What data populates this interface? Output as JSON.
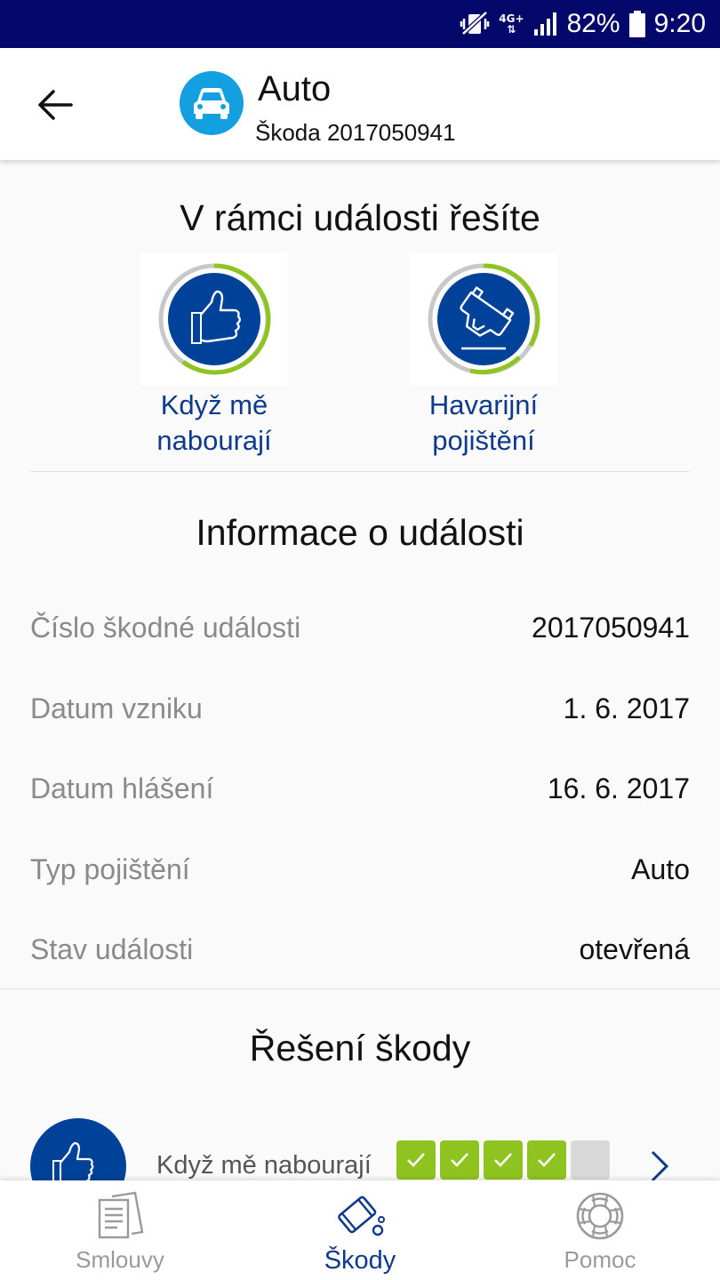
{
  "status_bar": {
    "mute_icon": "vibrate-mute-icon",
    "network": "4G+",
    "battery_percent": "82%",
    "time": "9:20"
  },
  "header": {
    "back_icon": "arrow-left-icon",
    "product_icon": "car-icon",
    "title": "Auto",
    "subtitle": "Škoda 2017050941"
  },
  "categories_section": {
    "title": "V rámci události řešíte",
    "items": [
      {
        "label_line1": "Když mě",
        "label_line2": "nabourají",
        "icon": "thumbs-up-icon"
      },
      {
        "label_line1": "Havarijní",
        "label_line2": "pojištění",
        "icon": "overturned-car-icon"
      }
    ]
  },
  "info_section": {
    "title": "Informace o události",
    "rows": [
      {
        "label": "Číslo škodné události",
        "value": "2017050941"
      },
      {
        "label": "Datum vzniku",
        "value": "1. 6. 2017"
      },
      {
        "label": "Datum hlášení",
        "value": "16. 6. 2017"
      },
      {
        "label": "Typ pojištění",
        "value": "Auto"
      },
      {
        "label": "Stav události",
        "value": "otevřená"
      }
    ]
  },
  "resolution_section": {
    "title": "Řešení škody",
    "items": [
      {
        "label": "Když mě nabourají",
        "steps_done": 4,
        "steps_total": 5
      }
    ]
  },
  "colors": {
    "status_bar": "#05086b",
    "brand_blue": "#0f3a8c",
    "icon_blue": "#00419a",
    "accent_green": "#8fc31f",
    "product_icon_bg": "#149fe0"
  },
  "bottom_nav": {
    "items": [
      {
        "label": "Smlouvy",
        "icon": "contracts-icon",
        "active": false
      },
      {
        "label": "Škody",
        "icon": "damages-icon",
        "active": true
      },
      {
        "label": "Pomoc",
        "icon": "lifebuoy-icon",
        "active": false
      }
    ]
  }
}
